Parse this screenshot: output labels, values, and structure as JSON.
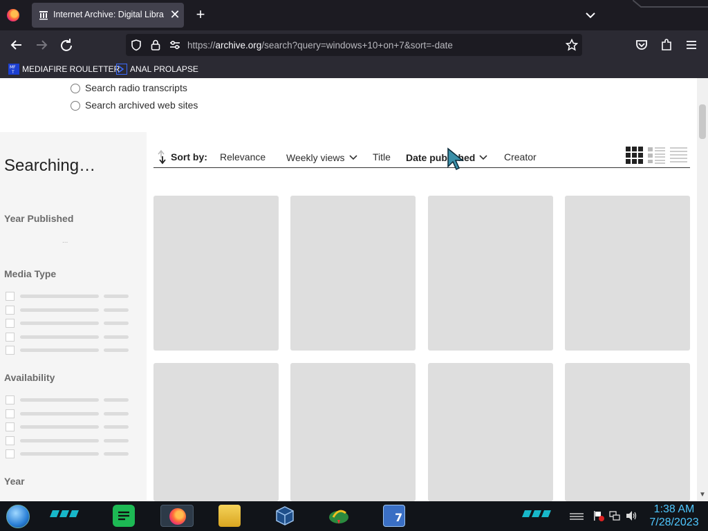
{
  "browser": {
    "tab": {
      "title": "Internet Archive: Digital Library",
      "close": "✕"
    },
    "new_tab": "+",
    "url": {
      "scheme": "https://",
      "domain": "archive.org",
      "path": "/search?query=windows+10+on+7&sort=-date"
    },
    "bookmarks": [
      {
        "label": "MEDIAFIRE ROULETTER",
        "icon": "mediafire-icon"
      },
      {
        "label": "ANAL PROLAPSE",
        "icon": "bookmark-icon"
      }
    ]
  },
  "search_options": {
    "radio_transcripts": "Search radio transcripts",
    "archived_web": "Search archived web sites"
  },
  "sidebar": {
    "status": "Searching…",
    "facets": {
      "year_published": "Year Published",
      "year_published_placeholder": "...",
      "media_type": "Media Type",
      "availability": "Availability",
      "year": "Year"
    }
  },
  "sort": {
    "label": "Sort by:",
    "options": {
      "relevance": "Relevance",
      "weekly_views": "Weekly views",
      "title": "Title",
      "date_published": "Date published",
      "creator": "Creator"
    },
    "active": "date_published"
  },
  "taskbar": {
    "time": "1:38 AM",
    "date": "7/28/2023"
  },
  "colors": {
    "accent": "#4fc8ff",
    "tile": "#dedede",
    "sidebar": "#f5f5f5"
  }
}
